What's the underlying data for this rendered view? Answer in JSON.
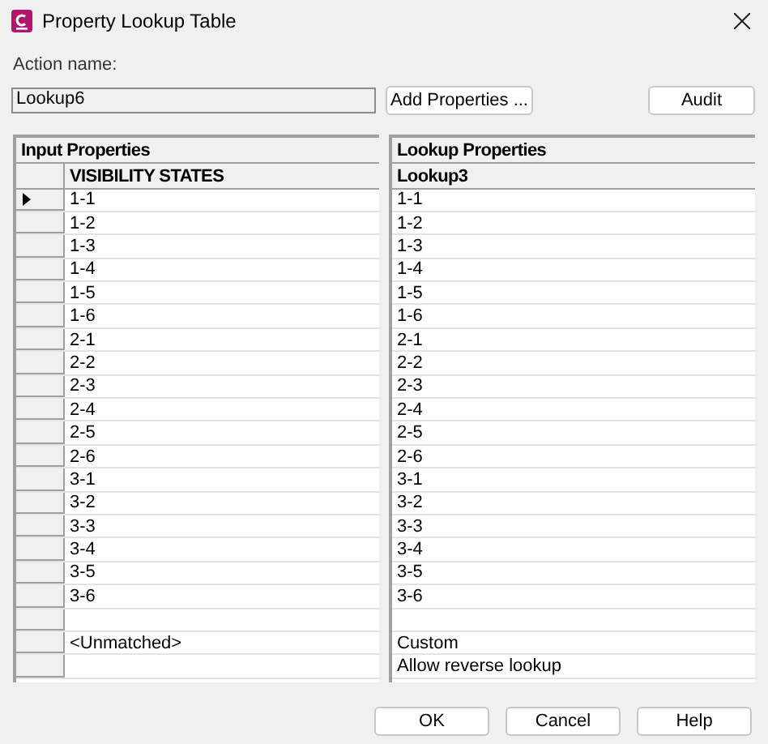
{
  "window": {
    "title": "Property Lookup Table"
  },
  "action_name": {
    "label": "Action name:",
    "value": "Lookup6"
  },
  "top_buttons": [
    "Add Properties ...",
    "Audit"
  ],
  "input_table": {
    "title": "Input Properties",
    "column": "VISIBILITY STATES",
    "rows": [
      {
        "value": "1-1",
        "current": true
      },
      {
        "value": "1-2",
        "current": false
      },
      {
        "value": "1-3",
        "current": false
      },
      {
        "value": "1-4",
        "current": false
      },
      {
        "value": "1-5",
        "current": false
      },
      {
        "value": "1-6",
        "current": false
      },
      {
        "value": "2-1",
        "current": false
      },
      {
        "value": "2-2",
        "current": false
      },
      {
        "value": "2-3",
        "current": false
      },
      {
        "value": "2-4",
        "current": false
      },
      {
        "value": "2-5",
        "current": false
      },
      {
        "value": "2-6",
        "current": false
      },
      {
        "value": "3-1",
        "current": false
      },
      {
        "value": "3-2",
        "current": false
      },
      {
        "value": "3-3",
        "current": false
      },
      {
        "value": "3-4",
        "current": false
      },
      {
        "value": "3-5",
        "current": false
      },
      {
        "value": "3-6",
        "current": false
      },
      {
        "current": false
      },
      {
        "value": "<Unmatched>",
        "current": false
      },
      {
        "current": false
      }
    ]
  },
  "lookup_table": {
    "title": "Lookup Properties",
    "column": "Lookup3",
    "rows": [
      {
        "value": "1-1"
      },
      {
        "value": "1-2"
      },
      {
        "value": "1-3"
      },
      {
        "value": "1-4"
      },
      {
        "value": "1-5"
      },
      {
        "value": "1-6"
      },
      {
        "value": "2-1"
      },
      {
        "value": "2-2"
      },
      {
        "value": "2-3"
      },
      {
        "value": "2-4"
      },
      {
        "value": "2-5"
      },
      {
        "value": "2-6"
      },
      {
        "value": "3-1"
      },
      {
        "value": "3-2"
      },
      {
        "value": "3-3"
      },
      {
        "value": "3-4"
      },
      {
        "value": "3-5"
      },
      {
        "value": "3-6"
      },
      {},
      {
        "value": "Custom"
      },
      {
        "value": "Allow reverse lookup"
      }
    ]
  },
  "buttons": [
    "OK",
    "Cancel",
    "Help"
  ]
}
